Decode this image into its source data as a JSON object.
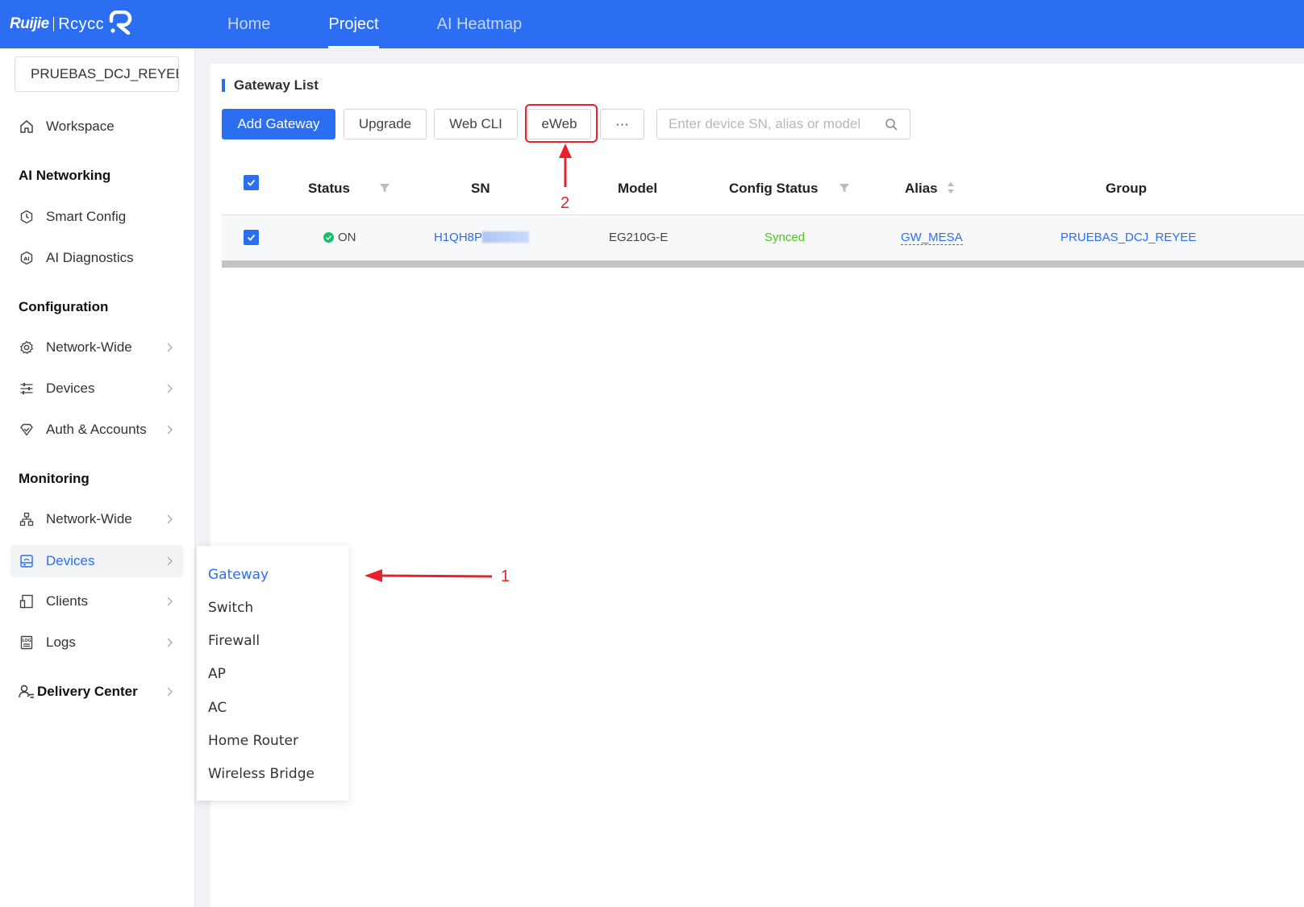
{
  "topbar": {
    "brand_ruijie": "Ruijie",
    "brand_reyee": "Rcycc",
    "nav": [
      "Home",
      "Project",
      "AI Heatmap"
    ],
    "active_nav": "Project"
  },
  "sidebar": {
    "project_name": "PRUEBAS_DCJ_REYEE",
    "workspace": "Workspace",
    "sections": {
      "ai_networking": "AI Networking",
      "configuration": "Configuration",
      "monitoring": "Monitoring",
      "delivery_center": "Delivery Center"
    },
    "items": {
      "smart_config": "Smart Config",
      "ai_diagnostics": "AI Diagnostics",
      "config_network_wide": "Network-Wide",
      "config_devices": "Devices",
      "auth_accounts": "Auth & Accounts",
      "mon_network_wide": "Network-Wide",
      "mon_devices": "Devices",
      "clients": "Clients",
      "logs": "Logs"
    }
  },
  "main": {
    "title": "Gateway List",
    "toolbar": {
      "add_gateway": "Add Gateway",
      "upgrade": "Upgrade",
      "web_cli": "Web CLI",
      "eweb": "eWeb",
      "more": "···",
      "search_placeholder": "Enter device SN, alias or model"
    },
    "columns": {
      "status": "Status",
      "sn": "SN",
      "model": "Model",
      "config_status": "Config Status",
      "alias": "Alias",
      "group": "Group"
    },
    "rows": [
      {
        "status": "ON",
        "sn": "H1QH8P",
        "model": "EG210G-E",
        "config_status": "Synced",
        "alias": "GW_MESA",
        "group": "PRUEBAS_DCJ_REYEE"
      }
    ]
  },
  "submenu": {
    "items": [
      "Gateway",
      "Switch",
      "Firewall",
      "AP",
      "AC",
      "Home Router",
      "Wireless Bridge"
    ],
    "active": "Gateway"
  },
  "annotations": {
    "label_1": "1",
    "label_2": "2",
    "color": "#e8222a"
  },
  "colors": {
    "primary": "#2b6ef2",
    "success": "#52c41a"
  }
}
